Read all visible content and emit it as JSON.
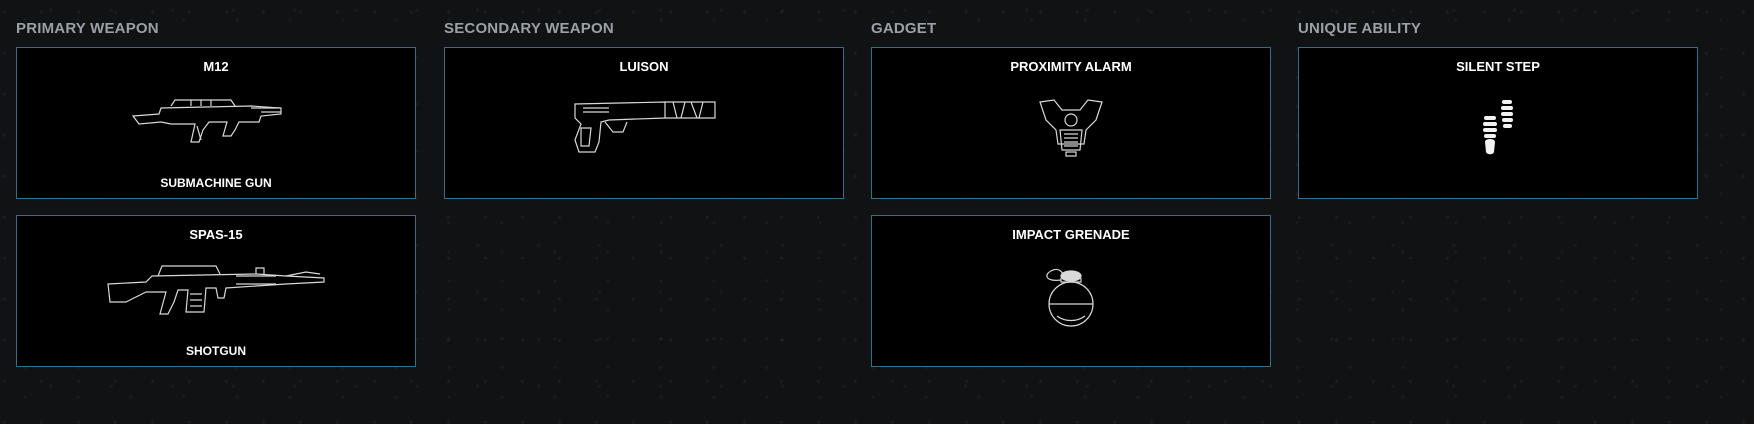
{
  "sections": {
    "primary": {
      "title": "PRIMARY WEAPON",
      "items": [
        {
          "name": "M12",
          "type": "SUBMACHINE GUN",
          "icon": "smg-icon"
        },
        {
          "name": "SPAS-15",
          "type": "SHOTGUN",
          "icon": "shotgun-icon"
        }
      ]
    },
    "secondary": {
      "title": "SECONDARY WEAPON",
      "items": [
        {
          "name": "LUISON",
          "icon": "pistol-icon"
        }
      ]
    },
    "gadget": {
      "title": "GADGET",
      "items": [
        {
          "name": "PROXIMITY ALARM",
          "icon": "proximity-alarm-icon"
        },
        {
          "name": "IMPACT GRENADE",
          "icon": "impact-grenade-icon"
        }
      ]
    },
    "ability": {
      "title": "UNIQUE ABILITY",
      "items": [
        {
          "name": "SILENT STEP",
          "icon": "footsteps-icon"
        }
      ]
    }
  },
  "colors": {
    "background": "#111214",
    "card_background": "#000000",
    "card_border": "#2e6f8e",
    "section_title": "#9aa0a6",
    "text": "#ffffff"
  }
}
